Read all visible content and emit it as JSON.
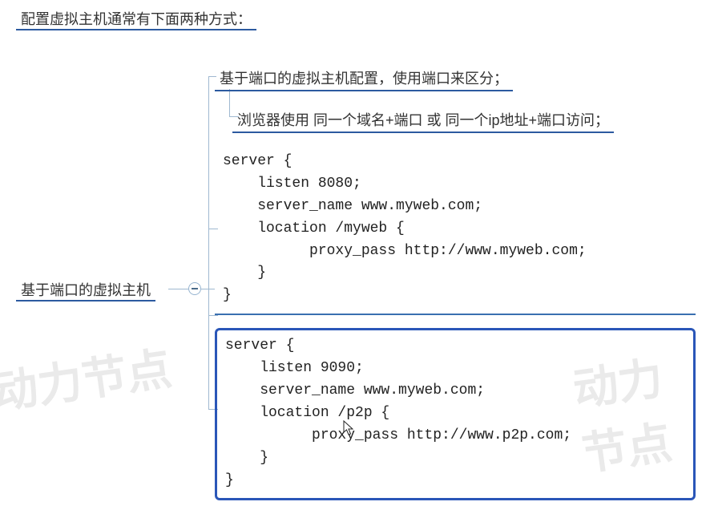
{
  "title": "配置虚拟主机通常有下面两种方式：",
  "watermark": "动力节点",
  "branch_label": "基于端口的虚拟主机",
  "collapse_toggle_label": "−",
  "sub_title": "基于端口的虚拟主机配置，使用端口来区分；",
  "sub_note": "浏览器使用 同一个域名+端口 或 同一个ip地址+端口访问；",
  "code_block_1": "server {\n    listen 8080;\n    server_name www.myweb.com;\n    location /myweb {\n          proxy_pass http://www.myweb.com;\n    }\n}",
  "code_block_2": "server {\n    listen 9090;\n    server_name www.myweb.com;\n    location /p2p {\n          proxy_pass http://www.p2p.com;\n    }\n}"
}
